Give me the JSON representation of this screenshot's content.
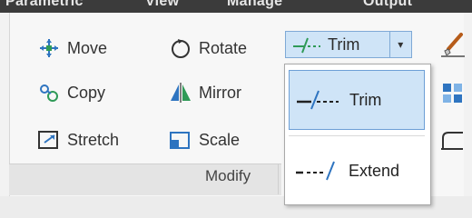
{
  "ribbon": {
    "tab_strip": [
      "Parametric",
      "View",
      "Manage",
      "Output"
    ],
    "panel_title": "Modify",
    "tools": {
      "move": "Move",
      "rotate": "Rotate",
      "copy": "Copy",
      "mirror": "Mirror",
      "stretch": "Stretch",
      "scale": "Scale"
    },
    "split_button": {
      "label": "Trim",
      "arrow": "▾"
    }
  },
  "dropdown": {
    "items": [
      {
        "label": "Trim",
        "selected": true
      },
      {
        "label": "Extend",
        "selected": false
      }
    ]
  },
  "colors": {
    "accent_fill": "#cfe4f7",
    "accent_border": "#6d9fd6",
    "icon_blue": "#2e74c0",
    "icon_green": "#2f9a57"
  }
}
